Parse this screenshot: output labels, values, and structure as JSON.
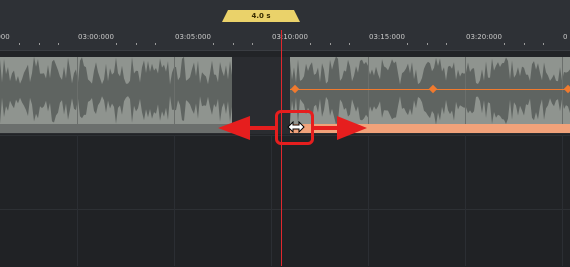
{
  "timeline": {
    "selection_length": "4.0 s",
    "ticks": [
      {
        "label": "03:00:000"
      },
      {
        "label": "03:05:000"
      },
      {
        "label": "03:10:000"
      },
      {
        "label": "03:15:000"
      },
      {
        "label": "03:20:000"
      }
    ],
    "left_partial_label": ":000",
    "right_partial_label": "0"
  },
  "colors": {
    "playhead": "#e0282e",
    "envelope": "#f07a2e",
    "selection_badge": "#ead26a",
    "clip_body": "#8f948f",
    "annotation_red": "#e61e1e"
  },
  "icons": {
    "trim_cursor": "horizontal-resize-cursor-icon",
    "arrows": "left-right-arrows-icon"
  }
}
